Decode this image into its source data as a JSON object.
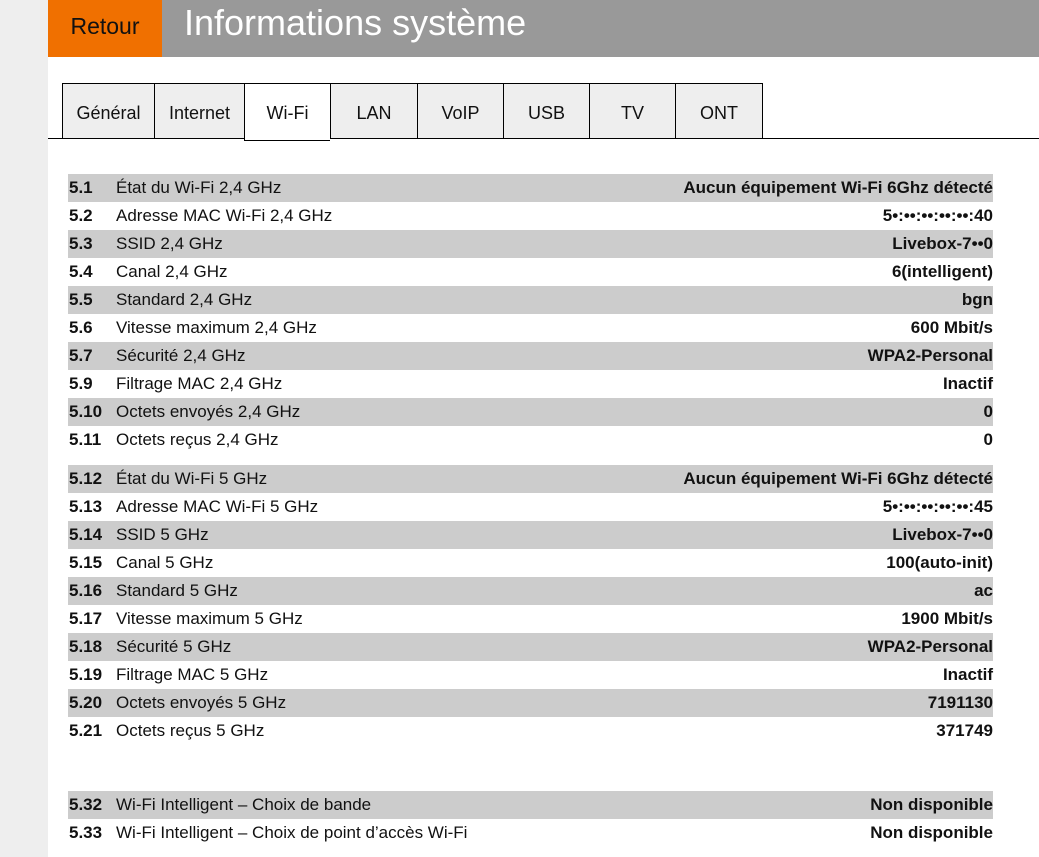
{
  "header": {
    "back": "Retour",
    "title": "Informations système"
  },
  "tabs": [
    "Général",
    "Internet",
    "Wi-Fi",
    "LAN",
    "VoIP",
    "USB",
    "TV",
    "ONT"
  ],
  "active_tab": "Wi-Fi",
  "groups": [
    [
      {
        "n": "5.1",
        "l": "État du Wi-Fi 2,4 GHz",
        "v": "Aucun équipement Wi-Fi 6Ghz détecté"
      },
      {
        "n": "5.2",
        "l": "Adresse MAC Wi-Fi 2,4 GHz",
        "v": "5•:••:••:••:••:40"
      },
      {
        "n": "5.3",
        "l": "SSID 2,4 GHz",
        "v": "Livebox-7••0"
      },
      {
        "n": "5.4",
        "l": "Canal 2,4 GHz",
        "v": "6(intelligent)"
      },
      {
        "n": "5.5",
        "l": "Standard 2,4 GHz",
        "v": "bgn"
      },
      {
        "n": "5.6",
        "l": "Vitesse maximum 2,4 GHz",
        "v": "600 Mbit/s"
      },
      {
        "n": "5.7",
        "l": "Sécurité 2,4 GHz",
        "v": "WPA2-Personal"
      },
      {
        "n": "5.9",
        "l": "Filtrage MAC 2,4 GHz",
        "v": "Inactif"
      },
      {
        "n": "5.10",
        "l": "Octets envoyés 2,4 GHz",
        "v": "0"
      },
      {
        "n": "5.11",
        "l": "Octets reçus 2,4 GHz",
        "v": "0"
      }
    ],
    [
      {
        "n": "5.12",
        "l": "État du Wi-Fi 5 GHz",
        "v": "Aucun équipement Wi-Fi 6Ghz détecté"
      },
      {
        "n": "5.13",
        "l": "Adresse MAC Wi-Fi 5 GHz",
        "v": "5•:••:••:••:••:45"
      },
      {
        "n": "5.14",
        "l": "SSID 5 GHz",
        "v": "Livebox-7••0"
      },
      {
        "n": "5.15",
        "l": "Canal 5 GHz",
        "v": "100(auto-init)"
      },
      {
        "n": "5.16",
        "l": "Standard 5 GHz",
        "v": "ac"
      },
      {
        "n": "5.17",
        "l": "Vitesse maximum 5 GHz",
        "v": "1900 Mbit/s"
      },
      {
        "n": "5.18",
        "l": "Sécurité 5 GHz",
        "v": "WPA2-Personal"
      },
      {
        "n": "5.19",
        "l": "Filtrage MAC 5 GHz",
        "v": "Inactif"
      },
      {
        "n": "5.20",
        "l": "Octets envoyés 5 GHz",
        "v": "7191130"
      },
      {
        "n": "5.21",
        "l": "Octets reçus 5 GHz",
        "v": "371749"
      }
    ],
    [
      {
        "n": "5.32",
        "l": "Wi-Fi Intelligent – Choix de bande",
        "v": "Non disponible"
      },
      {
        "n": "5.33",
        "l": "Wi-Fi Intelligent – Choix de point d’accès Wi-Fi",
        "v": "Non disponible"
      }
    ]
  ]
}
